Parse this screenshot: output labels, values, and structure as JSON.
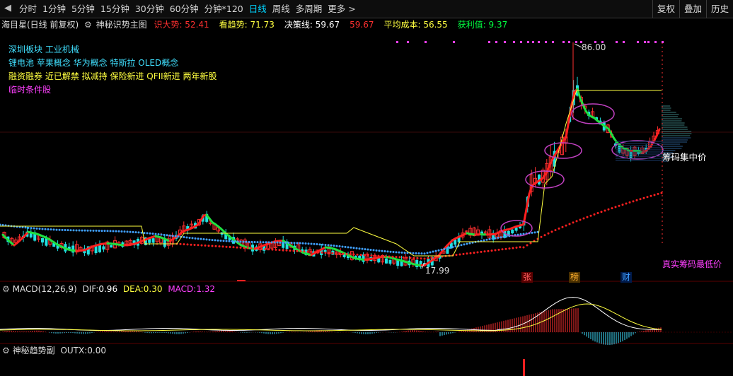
{
  "toolbar": {
    "periods": [
      "分时",
      "1分钟",
      "5分钟",
      "15分钟",
      "30分钟",
      "60分钟",
      "分钟*120",
      "日线",
      "周线",
      "多周期",
      "更多 >"
    ],
    "active_period": "日线",
    "right_buttons": [
      "复权",
      "叠加",
      "历史"
    ]
  },
  "title": {
    "stock": "海目星(日线 前复权)",
    "indicator_name": "神秘识势主图",
    "items": [
      {
        "label": "识大势:",
        "value": "52.41",
        "color": "#ff3030"
      },
      {
        "label": "看趋势:",
        "value": "71.73",
        "color": "#ffff40"
      },
      {
        "label": "决策线:",
        "value": "59.67",
        "color": "#ffffff"
      },
      {
        "label": "",
        "value": "59.67",
        "color": "#ff3030"
      },
      {
        "label": "平均成本:",
        "value": "56.55",
        "color": "#ffff40"
      },
      {
        "label": "获利值:",
        "value": "9.37",
        "color": "#00ff40"
      }
    ]
  },
  "concepts": [
    {
      "text": "深圳板块 工业机械",
      "color": "#40e0ff"
    },
    {
      "text": "锂电池 苹果概念 华为概念 特斯拉 OLED概念",
      "color": "#40e0ff"
    },
    {
      "text": "融资融券 近已解禁 拟减持 保险新进 QFII新进 两年新股",
      "color": "#ffff40"
    },
    {
      "text": "临时条件股",
      "color": "#ff40ff"
    }
  ],
  "annotations": {
    "high_price": "86.00",
    "low_price": "17.99",
    "chip_concentration": "筹码集中价",
    "true_chip_low": "真实筹码最低价",
    "event_markers": [
      "张",
      "榜",
      "财"
    ]
  },
  "macd": {
    "name": "MACD(12,26,9)",
    "dif_label": "DIF:",
    "dif": "0.96",
    "dea_label": "DEA:",
    "dea": "0.30",
    "macd_label": "MACD:",
    "macd": "1.32"
  },
  "sub": {
    "name": "神秘趋势副",
    "outx_label": "OUTX:",
    "outx": "0.00"
  },
  "colors": {
    "up": "#ff3030",
    "down": "#20e040",
    "accent": "#00d4ff",
    "dotline_blue": "#40a0ff",
    "dotline_red": "#ff2020",
    "magenta": "#ff40ff",
    "yellow": "#ffff40"
  }
}
